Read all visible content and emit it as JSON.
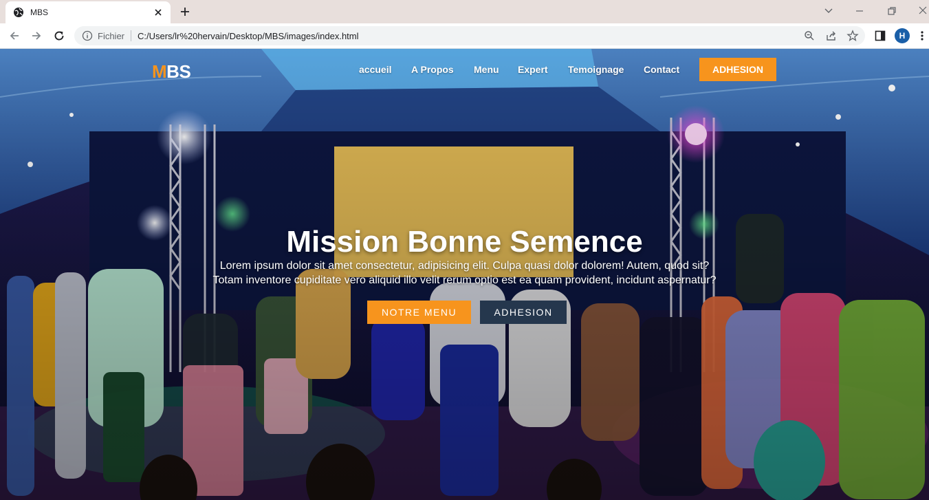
{
  "browser": {
    "tab_title": "MBS",
    "omnibox_scheme": "Fichier",
    "url": "C:/Users/lr%20hervain/Desktop/MBS/images/index.html",
    "profile_initial": "H"
  },
  "site": {
    "logo_m": "M",
    "logo_rest": "BS",
    "nav": {
      "items": [
        "accueil",
        "A Propos",
        "Menu",
        "Expert",
        "Temoignage",
        "Contact"
      ],
      "cta": "ADHESION"
    },
    "hero": {
      "title": "Mission Bonne Semence",
      "text_line1": "Lorem ipsum dolor sit amet consectetur, adipisicing elit. Culpa quasi dolor dolorem! Autem, quod sit?",
      "text_line2": "Totam inventore cupiditate vero aliquid illo velit rerum optio est ea quam provident, incidunt aspernatur?",
      "button_primary": "NOTRE MENU",
      "button_secondary": "ADHESION"
    }
  },
  "colors": {
    "accent": "#f7941d",
    "secondary_button": "#25374d",
    "tabstrip": "#e8dfdc"
  }
}
